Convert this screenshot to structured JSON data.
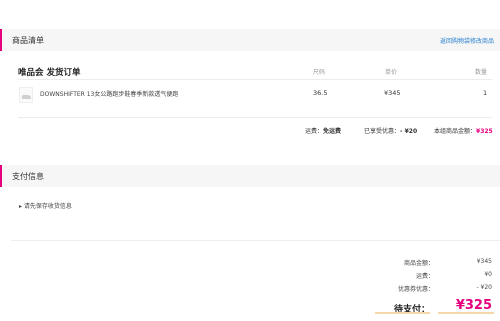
{
  "products_section": {
    "title": "商品清单",
    "back_link": "返回购物袋修改商品"
  },
  "order": {
    "store_title": "唯品会 发货订单",
    "columns": {
      "size": "尺码",
      "price": "单价",
      "qty": "数量"
    },
    "items": [
      {
        "name": "DOWNSHIFTER 13女公路跑步鞋春季新款透气便跑",
        "size": "36.5",
        "price": "¥345",
        "qty": "1"
      }
    ],
    "summary": {
      "shipping_label": "运费：",
      "shipping_value": "免运费",
      "discount_label": "已享受优惠：",
      "discount_value": "- ¥20",
      "total_label": "本组商品金额：",
      "total_value": "¥325"
    }
  },
  "payment_section": {
    "title": "支付信息",
    "note": "▸ 请先保存收货信息"
  },
  "totals": {
    "goods_amount_label": "商品金额：",
    "goods_amount_value": "¥345",
    "shipping_label": "运费：",
    "shipping_value": "¥0",
    "coupon_label": "优惠券优惠：",
    "coupon_value": "- ¥20",
    "pay_label": "待支付：",
    "pay_value": "¥325"
  },
  "colors": {
    "accent": "#e4007f",
    "link": "#2a7fd0",
    "header_bg": "#f6f6f6"
  }
}
